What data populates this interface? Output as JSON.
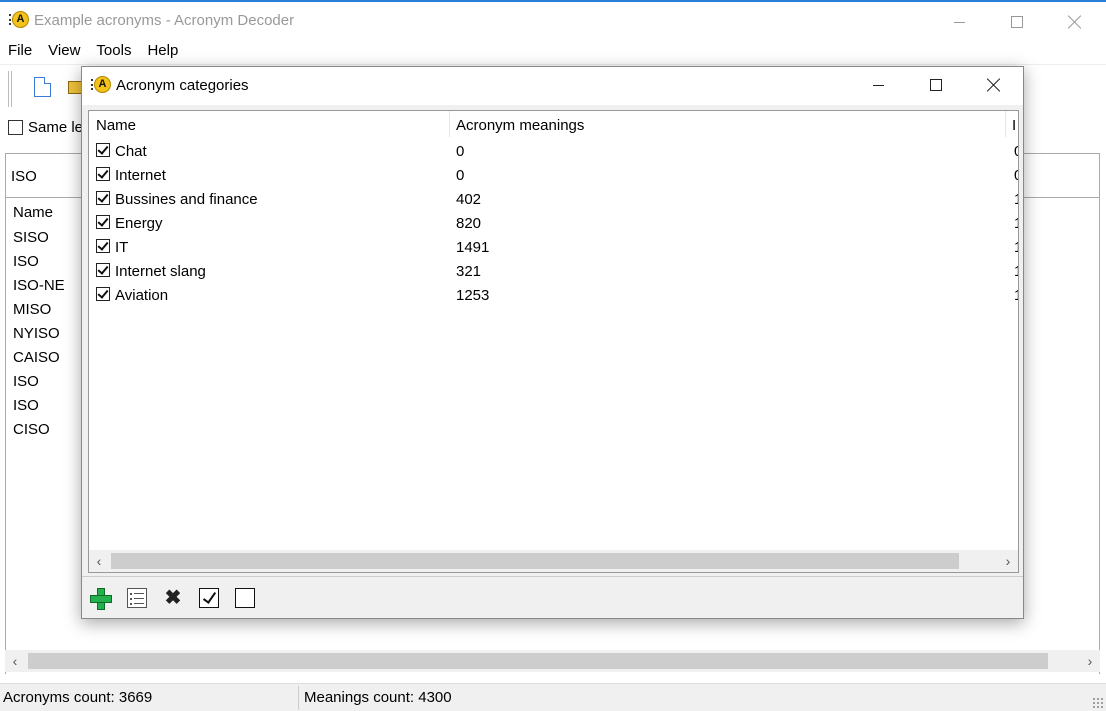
{
  "main_window": {
    "title": "Example acronyms - Acronym Decoder",
    "menu": [
      "File",
      "View",
      "Tools",
      "Help"
    ],
    "same_length_label": "Same le",
    "search_value": "ISO",
    "list_header": "Name",
    "acronyms": [
      "SISO",
      "ISO",
      "ISO-NE",
      "MISO",
      "NYISO",
      "CAISO",
      "ISO",
      "ISO",
      "CISO"
    ],
    "status": {
      "acronyms_count": "Acronyms count: 3669",
      "meanings_count": "Meanings count: 4300"
    }
  },
  "dialog": {
    "title": "Acronym categories",
    "columns": [
      "Name",
      "Acronym meanings",
      "I"
    ],
    "categories": [
      {
        "name": "Chat",
        "meanings": "0",
        "extra": "0",
        "checked": true
      },
      {
        "name": "Internet",
        "meanings": "0",
        "extra": "0",
        "checked": true
      },
      {
        "name": "Bussines and finance",
        "meanings": "402",
        "extra": "1",
        "checked": true
      },
      {
        "name": "Energy",
        "meanings": "820",
        "extra": "1",
        "checked": true
      },
      {
        "name": "IT",
        "meanings": "1491",
        "extra": "1",
        "checked": true
      },
      {
        "name": "Internet slang",
        "meanings": "321",
        "extra": "1",
        "checked": true
      },
      {
        "name": "Aviation",
        "meanings": "1253",
        "extra": "1",
        "checked": true
      }
    ],
    "toolbar_icons": [
      "add-icon",
      "properties-icon",
      "delete-icon",
      "check-all-icon",
      "uncheck-all-icon"
    ]
  },
  "colors": {
    "accent": "#2b7fd8",
    "add_green": "#22b14c",
    "app_icon_yellow": "#f3c21b"
  }
}
